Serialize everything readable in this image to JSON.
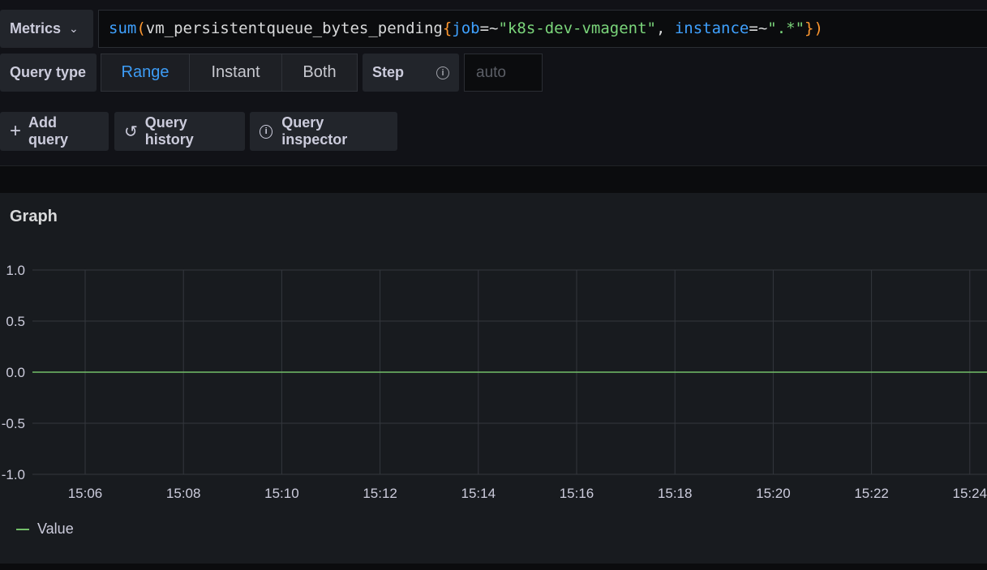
{
  "query_row": {
    "datasource_button": "Metrics",
    "query_tokens": [
      {
        "text": "sum",
        "cls": "tok-fn"
      },
      {
        "text": "(",
        "cls": "tok-paren"
      },
      {
        "text": "vm_persistentqueue_bytes_pending",
        "cls": "tok-metric"
      },
      {
        "text": "{",
        "cls": "tok-brace"
      },
      {
        "text": "job",
        "cls": "tok-label"
      },
      {
        "text": "=~",
        "cls": "tok-op"
      },
      {
        "text": "\"k8s-dev-vmagent\"",
        "cls": "tok-str"
      },
      {
        "text": ", ",
        "cls": "tok-op"
      },
      {
        "text": "instance",
        "cls": "tok-label"
      },
      {
        "text": "=~",
        "cls": "tok-op"
      },
      {
        "text": "\".*\"",
        "cls": "tok-str"
      },
      {
        "text": "}",
        "cls": "tok-brace"
      },
      {
        "text": ")",
        "cls": "tok-paren"
      }
    ]
  },
  "options_row": {
    "query_type_label": "Query type",
    "query_types": [
      "Range",
      "Instant",
      "Both"
    ],
    "active_query_type": "Range",
    "step_label": "Step",
    "step_placeholder": "auto"
  },
  "actions": {
    "add_query": "Add query",
    "query_history": "Query history",
    "query_inspector": "Query inspector"
  },
  "panel": {
    "title": "Graph"
  },
  "colors": {
    "accent": "#3d9cf5",
    "series": "#73bf69"
  },
  "chart_data": {
    "type": "line",
    "title": "Graph",
    "x_ticks": [
      "15:06",
      "15:08",
      "15:10",
      "15:12",
      "15:14",
      "15:16",
      "15:18",
      "15:20",
      "15:22",
      "15:24"
    ],
    "y_ticks": [
      "1.0",
      "0.5",
      "0.0",
      "-0.5",
      "-1.0"
    ],
    "ylim": [
      -1.0,
      1.0
    ],
    "x": [
      "15:05",
      "15:24"
    ],
    "series": [
      {
        "name": "Value",
        "values": [
          0,
          0
        ],
        "color": "#73bf69"
      }
    ],
    "grid": true,
    "legend_placement": "bottom-left"
  }
}
